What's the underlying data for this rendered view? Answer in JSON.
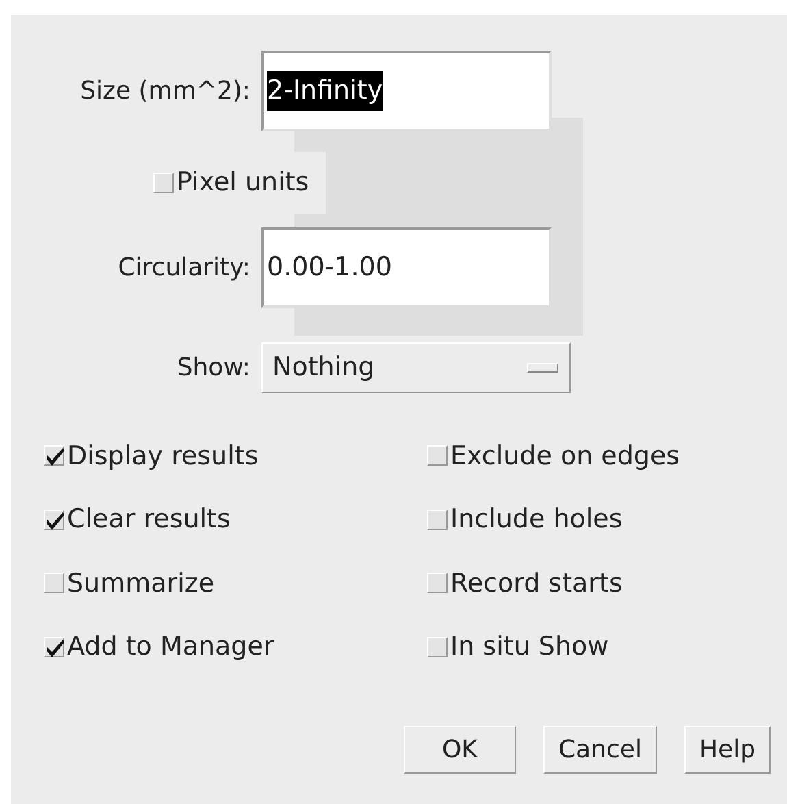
{
  "fields": [
    {
      "label": "Size (mm^2):",
      "value": "2-Infinity",
      "selected": true
    },
    {
      "label": "Circularity:",
      "value": "0.00-1.00",
      "selected": false
    }
  ],
  "pixel_units": {
    "label": "Pixel units",
    "checked": false
  },
  "show": {
    "label": "Show:",
    "value": "Nothing"
  },
  "options": [
    {
      "label": "Display results",
      "checked": true
    },
    {
      "label": "Exclude on edges",
      "checked": false
    },
    {
      "label": "Clear results",
      "checked": true
    },
    {
      "label": "Include holes",
      "checked": false
    },
    {
      "label": "Summarize",
      "checked": false
    },
    {
      "label": "Record starts",
      "checked": false
    },
    {
      "label": "Add to Manager",
      "checked": true
    },
    {
      "label": "In situ Show",
      "checked": false
    }
  ],
  "buttons": [
    "OK",
    "Cancel",
    "Help"
  ]
}
